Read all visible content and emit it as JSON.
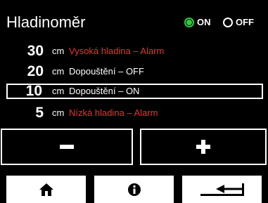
{
  "header": {
    "title": "Hladinoměr",
    "on_label": "ON",
    "off_label": "OFF",
    "selected": "ON"
  },
  "levels": [
    {
      "value": "30",
      "unit": "cm",
      "description": "Vysoká hladina – Alarm",
      "color": "#e8352e"
    },
    {
      "value": "20",
      "unit": "cm",
      "description": "Dopouštění – OFF",
      "color": "#ffffff"
    },
    {
      "value": "10",
      "unit": "cm",
      "description": "Dopouštění – ON",
      "color": "#ffffff",
      "selected": true
    },
    {
      "value": "5",
      "unit": "cm",
      "description": "Nízká hladina – Alarm",
      "color": "#e8352e"
    }
  ],
  "controls": {
    "minus_icon": "minus-icon",
    "plus_icon": "plus-icon"
  },
  "navigation": {
    "home_icon": "home-icon",
    "info_icon": "info-icon",
    "back_icon": "return-icon"
  },
  "colors": {
    "alarm": "#e8352e",
    "active": "#2ecc40",
    "background": "#000000",
    "foreground": "#ffffff"
  }
}
